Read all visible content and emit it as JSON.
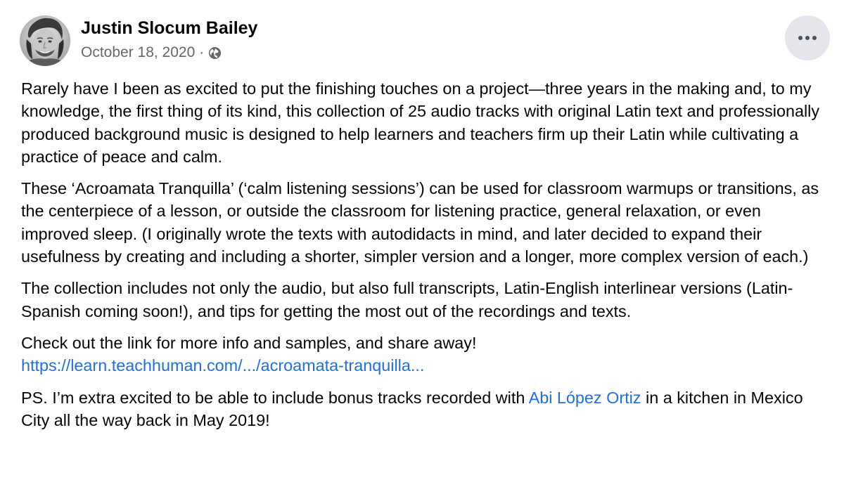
{
  "post": {
    "author": "Justin Slocum Bailey",
    "date": "October 18, 2020",
    "separator": "·",
    "audience_icon": "globe-icon",
    "more_icon": "more-horizontal-icon"
  },
  "content": {
    "p1": "Rarely have I been as excited to put the finishing touches on a project—three years in the making and, to my knowledge, the first thing of its kind, this collection of 25 audio tracks with original Latin text and professionally produced background music is designed to help learners and teachers firm up their Latin while cultivating a practice of peace and calm.",
    "p2": "These ‘Acroamata Tranquilla’ (‘calm listening sessions’) can be used for classroom warmups or transitions, as the centerpiece of a lesson, or outside the classroom for listening practice, general relaxation, or even improved sleep. (I originally wrote the texts with autodidacts in mind, and later decided to expand their usefulness by creating and including a shorter, simpler version and a longer, more complex version of each.)",
    "p3": "The collection includes not only the audio, but also full transcripts, Latin-English interlinear versions (Latin-Spanish coming soon!), and tips for getting the most out of the recordings and texts.",
    "p4": "Check out the link for more info and samples, and share away!",
    "link": "https://learn.teachhuman.com/.../acroamata-tranquilla...",
    "p5_before": "PS. I’m extra excited to be able to include bonus tracks recorded with ",
    "p5_mention": "Abi López Ortiz",
    "p5_after": " in a kitchen in Mexico City all the way back in May 2019!"
  },
  "colors": {
    "text": "#050505",
    "secondary": "#65676b",
    "link": "#216fdb",
    "button_bg": "#e4e6eb"
  }
}
